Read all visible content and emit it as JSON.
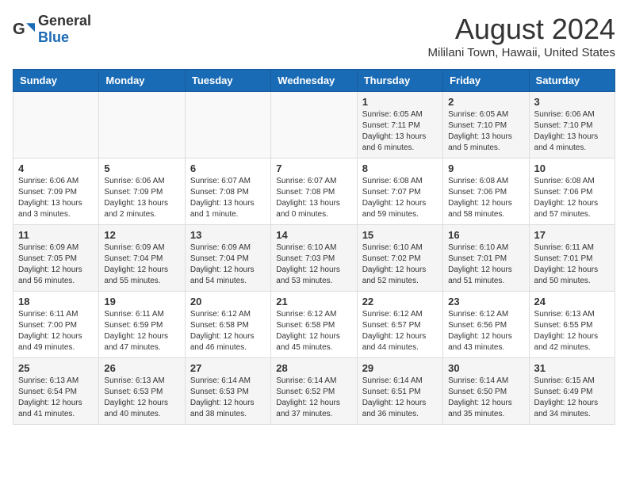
{
  "header": {
    "logo_general": "General",
    "logo_blue": "Blue",
    "month": "August 2024",
    "location": "Mililani Town, Hawaii, United States"
  },
  "days_of_week": [
    "Sunday",
    "Monday",
    "Tuesday",
    "Wednesday",
    "Thursday",
    "Friday",
    "Saturday"
  ],
  "weeks": [
    [
      {
        "day": "",
        "info": ""
      },
      {
        "day": "",
        "info": ""
      },
      {
        "day": "",
        "info": ""
      },
      {
        "day": "",
        "info": ""
      },
      {
        "day": "1",
        "info": "Sunrise: 6:05 AM\nSunset: 7:11 PM\nDaylight: 13 hours\nand 6 minutes."
      },
      {
        "day": "2",
        "info": "Sunrise: 6:05 AM\nSunset: 7:10 PM\nDaylight: 13 hours\nand 5 minutes."
      },
      {
        "day": "3",
        "info": "Sunrise: 6:06 AM\nSunset: 7:10 PM\nDaylight: 13 hours\nand 4 minutes."
      }
    ],
    [
      {
        "day": "4",
        "info": "Sunrise: 6:06 AM\nSunset: 7:09 PM\nDaylight: 13 hours\nand 3 minutes."
      },
      {
        "day": "5",
        "info": "Sunrise: 6:06 AM\nSunset: 7:09 PM\nDaylight: 13 hours\nand 2 minutes."
      },
      {
        "day": "6",
        "info": "Sunrise: 6:07 AM\nSunset: 7:08 PM\nDaylight: 13 hours\nand 1 minute."
      },
      {
        "day": "7",
        "info": "Sunrise: 6:07 AM\nSunset: 7:08 PM\nDaylight: 13 hours\nand 0 minutes."
      },
      {
        "day": "8",
        "info": "Sunrise: 6:08 AM\nSunset: 7:07 PM\nDaylight: 12 hours\nand 59 minutes."
      },
      {
        "day": "9",
        "info": "Sunrise: 6:08 AM\nSunset: 7:06 PM\nDaylight: 12 hours\nand 58 minutes."
      },
      {
        "day": "10",
        "info": "Sunrise: 6:08 AM\nSunset: 7:06 PM\nDaylight: 12 hours\nand 57 minutes."
      }
    ],
    [
      {
        "day": "11",
        "info": "Sunrise: 6:09 AM\nSunset: 7:05 PM\nDaylight: 12 hours\nand 56 minutes."
      },
      {
        "day": "12",
        "info": "Sunrise: 6:09 AM\nSunset: 7:04 PM\nDaylight: 12 hours\nand 55 minutes."
      },
      {
        "day": "13",
        "info": "Sunrise: 6:09 AM\nSunset: 7:04 PM\nDaylight: 12 hours\nand 54 minutes."
      },
      {
        "day": "14",
        "info": "Sunrise: 6:10 AM\nSunset: 7:03 PM\nDaylight: 12 hours\nand 53 minutes."
      },
      {
        "day": "15",
        "info": "Sunrise: 6:10 AM\nSunset: 7:02 PM\nDaylight: 12 hours\nand 52 minutes."
      },
      {
        "day": "16",
        "info": "Sunrise: 6:10 AM\nSunset: 7:01 PM\nDaylight: 12 hours\nand 51 minutes."
      },
      {
        "day": "17",
        "info": "Sunrise: 6:11 AM\nSunset: 7:01 PM\nDaylight: 12 hours\nand 50 minutes."
      }
    ],
    [
      {
        "day": "18",
        "info": "Sunrise: 6:11 AM\nSunset: 7:00 PM\nDaylight: 12 hours\nand 49 minutes."
      },
      {
        "day": "19",
        "info": "Sunrise: 6:11 AM\nSunset: 6:59 PM\nDaylight: 12 hours\nand 47 minutes."
      },
      {
        "day": "20",
        "info": "Sunrise: 6:12 AM\nSunset: 6:58 PM\nDaylight: 12 hours\nand 46 minutes."
      },
      {
        "day": "21",
        "info": "Sunrise: 6:12 AM\nSunset: 6:58 PM\nDaylight: 12 hours\nand 45 minutes."
      },
      {
        "day": "22",
        "info": "Sunrise: 6:12 AM\nSunset: 6:57 PM\nDaylight: 12 hours\nand 44 minutes."
      },
      {
        "day": "23",
        "info": "Sunrise: 6:12 AM\nSunset: 6:56 PM\nDaylight: 12 hours\nand 43 minutes."
      },
      {
        "day": "24",
        "info": "Sunrise: 6:13 AM\nSunset: 6:55 PM\nDaylight: 12 hours\nand 42 minutes."
      }
    ],
    [
      {
        "day": "25",
        "info": "Sunrise: 6:13 AM\nSunset: 6:54 PM\nDaylight: 12 hours\nand 41 minutes."
      },
      {
        "day": "26",
        "info": "Sunrise: 6:13 AM\nSunset: 6:53 PM\nDaylight: 12 hours\nand 40 minutes."
      },
      {
        "day": "27",
        "info": "Sunrise: 6:14 AM\nSunset: 6:53 PM\nDaylight: 12 hours\nand 38 minutes."
      },
      {
        "day": "28",
        "info": "Sunrise: 6:14 AM\nSunset: 6:52 PM\nDaylight: 12 hours\nand 37 minutes."
      },
      {
        "day": "29",
        "info": "Sunrise: 6:14 AM\nSunset: 6:51 PM\nDaylight: 12 hours\nand 36 minutes."
      },
      {
        "day": "30",
        "info": "Sunrise: 6:14 AM\nSunset: 6:50 PM\nDaylight: 12 hours\nand 35 minutes."
      },
      {
        "day": "31",
        "info": "Sunrise: 6:15 AM\nSunset: 6:49 PM\nDaylight: 12 hours\nand 34 minutes."
      }
    ]
  ]
}
